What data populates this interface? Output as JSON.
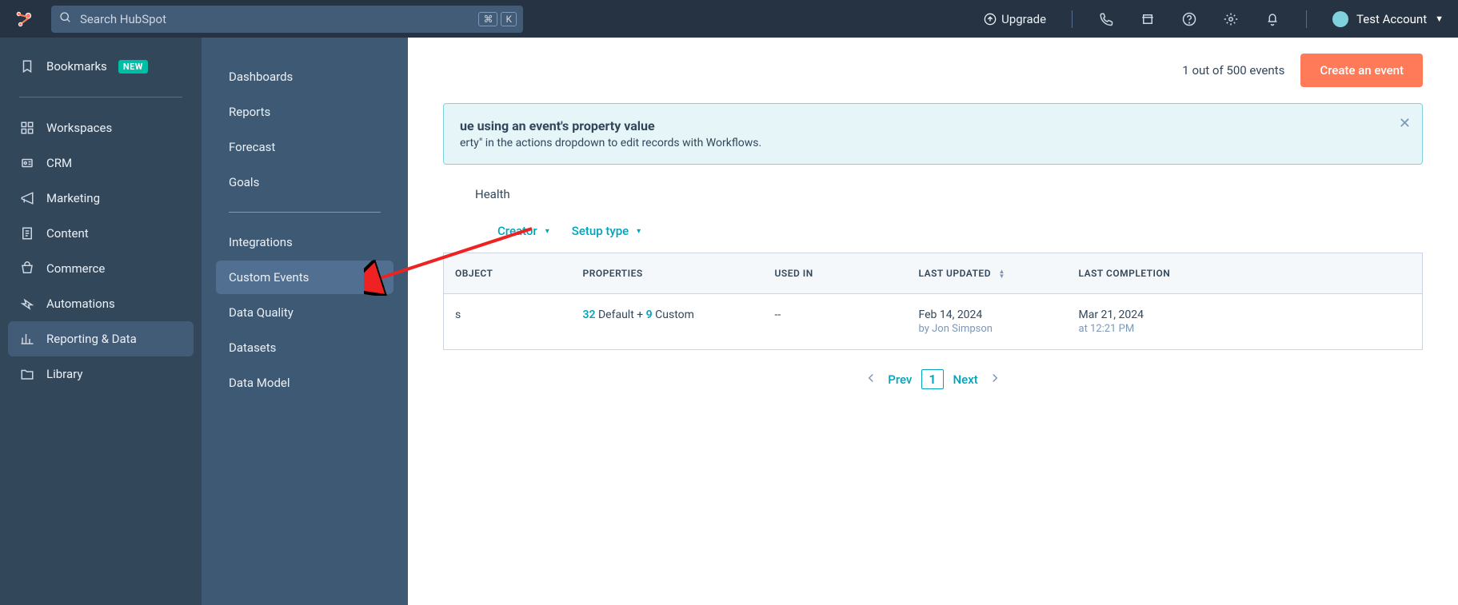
{
  "topbar": {
    "search_placeholder": "Search HubSpot",
    "kbd1": "⌘",
    "kbd2": "K",
    "upgrade": "Upgrade",
    "account_name": "Test Account"
  },
  "sidebar_primary": {
    "bookmarks": "Bookmarks",
    "bookmarks_badge": "NEW",
    "workspaces": "Workspaces",
    "crm": "CRM",
    "marketing": "Marketing",
    "content": "Content",
    "commerce": "Commerce",
    "automations": "Automations",
    "reporting": "Reporting & Data",
    "library": "Library"
  },
  "sidebar_secondary": {
    "dashboards": "Dashboards",
    "reports": "Reports",
    "forecast": "Forecast",
    "goals": "Goals",
    "integrations": "Integrations",
    "custom_events": "Custom Events",
    "data_quality": "Data Quality",
    "datasets": "Datasets",
    "data_model": "Data Model"
  },
  "page": {
    "event_count": "1 out of 500 events",
    "create_btn": "Create an event"
  },
  "banner": {
    "title_fragment": "ue using an event's property value",
    "text_fragment": "erty\" in the actions dropdown to edit records with Workflows."
  },
  "tabs": {
    "health": "Health"
  },
  "filters": {
    "creator": "Creator",
    "setup_type": "Setup type"
  },
  "table": {
    "headers": {
      "object": "OBJECT",
      "properties": "PROPERTIES",
      "used_in": "USED IN",
      "last_updated": "LAST UPDATED",
      "last_completion": "LAST COMPLETION"
    },
    "rows": [
      {
        "object": "s",
        "prop_default_count": "32",
        "prop_default_word": " Default + ",
        "prop_custom_count": "9",
        "prop_custom_word": " Custom",
        "used_in": "--",
        "last_updated_date": "Feb 14, 2024",
        "last_updated_by": "by Jon Simpson",
        "last_completion_date": "Mar 21, 2024",
        "last_completion_time": "at 12:21 PM"
      }
    ]
  },
  "pagination": {
    "prev": "Prev",
    "page": "1",
    "next": "Next"
  }
}
